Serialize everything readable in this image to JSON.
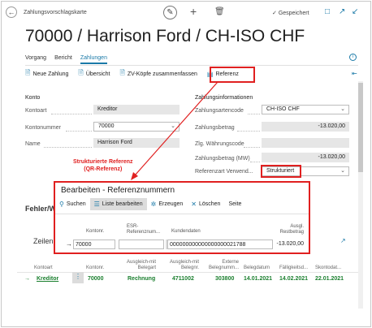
{
  "header": {
    "card_type": "Zahlungsvorschlagskarte",
    "saved_label": "Gespeichert",
    "title": "70000 / Harrison Ford / CH-ISO CHF"
  },
  "tabs": [
    {
      "label": "Vorgang"
    },
    {
      "label": "Bericht"
    },
    {
      "label": "Zahlungen"
    }
  ],
  "actions": {
    "neue_zahlung": "Neue Zahlung",
    "uebersicht": "Übersicht",
    "zv_koepfe": "ZV-Köpfe zusammenfassen",
    "referenz": "Referenz"
  },
  "konto": {
    "heading": "Konto",
    "kontoart_label": "Kontoart",
    "kontoart_value": "Kreditor",
    "kontonummer_label": "Kontonummer",
    "kontonummer_value": "70000",
    "name_label": "Name",
    "name_value": "Harrison Ford"
  },
  "zahlung": {
    "heading": "Zahlungsinformationen",
    "code_label": "Zahlungsartencode",
    "code_value": "CH-ISO CHF",
    "betrag_label": "Zahlungsbetrag",
    "betrag_value": "-13.020,00",
    "waehrung_label": "Zlg. Währungscode",
    "waehrung_value": "",
    "betrag_mw_label": "Zahlungsbetrag (MW)",
    "betrag_mw_value": "-13.020,00",
    "refart_label": "Referenzart Verwend...",
    "refart_value": "Strukturiert"
  },
  "annotation": {
    "line1": "Strukturierte Referenz",
    "line2": "(QR-Referenz)"
  },
  "dialog": {
    "title": "Bearbeiten - Referenznummern",
    "actions": {
      "suchen": "Suchen",
      "liste": "Liste bearbeiten",
      "erzeugen": "Erzeugen",
      "loeschen": "Löschen",
      "seite": "Seite"
    },
    "columns": {
      "kontonr": "Kontonr.",
      "esr1": "ESR-",
      "esr2": "Referenznum...",
      "kundendaten": "Kundendaten",
      "ausgl1": "Ausgl.",
      "ausgl2": "Restbetrag"
    },
    "row": {
      "kontonr": "70000",
      "kundendaten": "000000000000000000021788",
      "restbetrag": "-13.020,00"
    }
  },
  "background": {
    "fehler": "Fehler/W",
    "zeilen": "Zeilen",
    "columns": {
      "kontoart": "Kontoart",
      "kontonr": "Kontonr.",
      "ausgleich1": "Ausgleich-mit",
      "ausgleich2": "Belegart",
      "ausgleichnr1": "Ausgleich-mit",
      "ausgleichnr2": "Belegnr.",
      "extern1": "Externe",
      "extern2": "Belegnumm...",
      "belegdatum": "Belegdatum",
      "faellig": "Fälligkeitsd...",
      "skonto": "Skontodat..."
    },
    "row": {
      "kontoart": "Kreditor",
      "kontonr": "70000",
      "belegart": "Rechnung",
      "belegnr": "4711002",
      "extern": "303800",
      "belegdatum": "14.01.2021",
      "faellig": "14.02.2021",
      "skonto": "22.01.2021"
    }
  },
  "colors": {
    "accent": "#1b7aa8",
    "highlight": "#e02020",
    "green": "#1a7f2e"
  }
}
